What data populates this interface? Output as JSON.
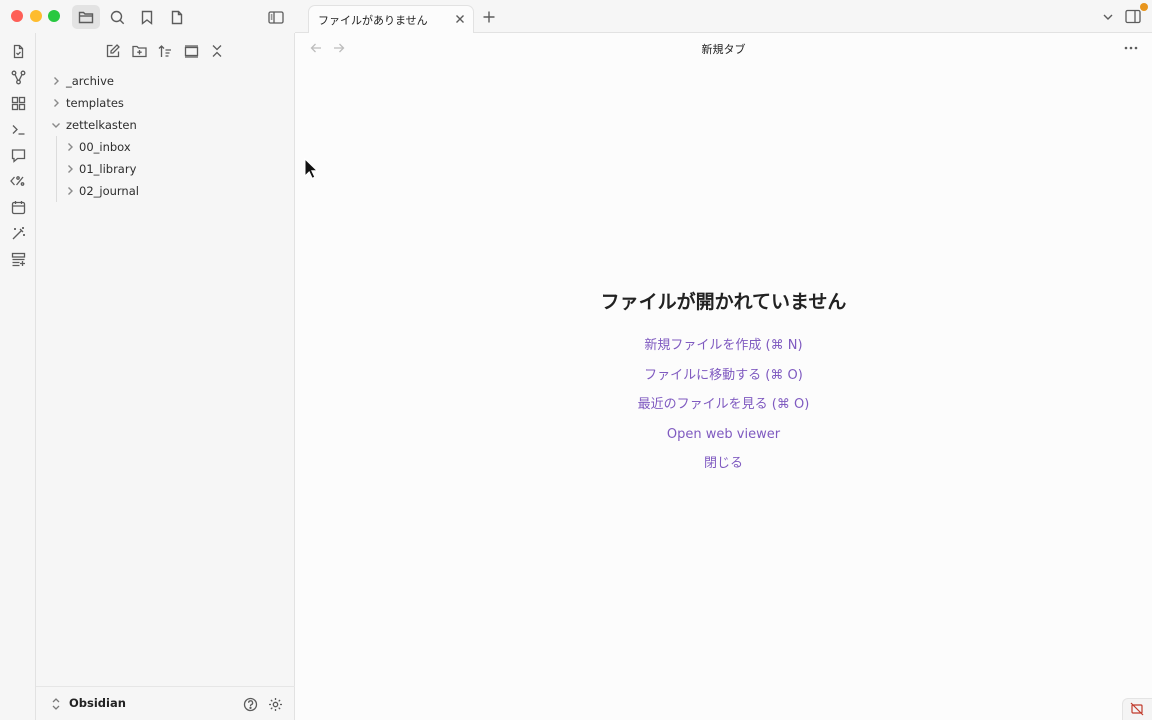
{
  "titlebar": {
    "icons": [
      "folder-icon",
      "search-icon",
      "bookmark-icon",
      "file-icon",
      "sidebar-toggle-icon"
    ]
  },
  "tabs": [
    {
      "title": "ファイルがありません"
    }
  ],
  "view": {
    "title": "新規タブ"
  },
  "ribbon": {
    "icons": [
      "file-switcher-icon",
      "graph-icon",
      "canvas-icon",
      "terminal-icon",
      "comment-icon",
      "templater-icon",
      "calendar-icon",
      "wand-icon",
      "sheets-icon"
    ]
  },
  "sidebar": {
    "toolbar_icons": [
      "new-note-icon",
      "new-folder-icon",
      "sort-icon",
      "auto-reveal-icon",
      "collapse-all-icon"
    ],
    "tree": [
      {
        "label": "_archive",
        "expanded": false,
        "depth": 0
      },
      {
        "label": "templates",
        "expanded": false,
        "depth": 0
      },
      {
        "label": "zettelkasten",
        "expanded": true,
        "depth": 0
      },
      {
        "label": "00_inbox",
        "expanded": false,
        "depth": 1
      },
      {
        "label": "01_library",
        "expanded": false,
        "depth": 1
      },
      {
        "label": "02_journal",
        "expanded": false,
        "depth": 1
      }
    ],
    "vault_name": "Obsidian"
  },
  "empty_state": {
    "title": "ファイルが開かれていません",
    "actions": [
      "新規ファイルを作成 (⌘ N)",
      "ファイルに移動する (⌘ O)",
      "最近のファイルを見る (⌘ O)",
      "Open web viewer",
      "閉じる"
    ]
  },
  "colors": {
    "accent": "#7f5ac0",
    "update_dot": "#e8951c"
  }
}
